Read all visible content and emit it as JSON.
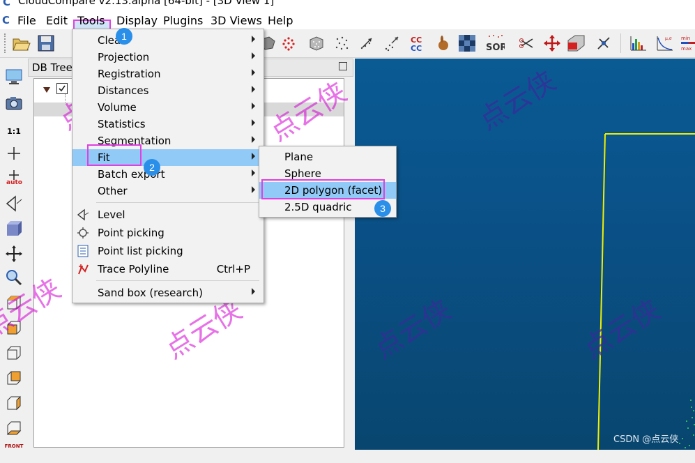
{
  "window": {
    "title": "CloudCompare v2.13.alpha [64-bit] - [3D View 1]"
  },
  "menubar": {
    "items": [
      "File",
      "Edit",
      "Tools",
      "Display",
      "Plugins",
      "3D Views",
      "Help"
    ],
    "active": "Tools"
  },
  "db_tree": {
    "title": "DB Tree"
  },
  "tools_menu": {
    "items": [
      {
        "label": "Clean",
        "has_submenu": true
      },
      {
        "label": "Projection",
        "has_submenu": true
      },
      {
        "label": "Registration",
        "has_submenu": true
      },
      {
        "label": "Distances",
        "has_submenu": true
      },
      {
        "label": "Volume",
        "has_submenu": true
      },
      {
        "label": "Statistics",
        "has_submenu": true
      },
      {
        "label": "Segmentation",
        "has_submenu": true
      },
      {
        "label": "Fit",
        "has_submenu": true,
        "highlighted": true
      },
      {
        "label": "Batch export",
        "has_submenu": true
      },
      {
        "label": "Other",
        "has_submenu": true
      },
      {
        "label": "Level",
        "icon": "level-icon"
      },
      {
        "label": "Point picking",
        "icon": "point-picking-icon"
      },
      {
        "label": "Point list picking",
        "icon": "point-list-icon"
      },
      {
        "label": "Trace Polyline",
        "icon": "trace-polyline-icon",
        "shortcut": "Ctrl+P"
      },
      {
        "label": "Sand box (research)",
        "has_submenu": true
      }
    ]
  },
  "fit_submenu": {
    "items": [
      {
        "label": "Plane"
      },
      {
        "label": "Sphere"
      },
      {
        "label": "2D polygon (facet)",
        "highlighted": true
      },
      {
        "label": "2.5D quadric"
      }
    ]
  },
  "callouts": [
    "1",
    "2",
    "3"
  ],
  "watermark_text": "点云侠",
  "left_toolbar": {
    "scale_label": "1:1",
    "auto_label": "auto",
    "front_label": "FRONT"
  },
  "toolbar_labels": {
    "sor": "SOR",
    "cc": "CC"
  },
  "credit": "CSDN @点云侠",
  "colors": {
    "highlight": "#91c9f7",
    "annotation": "#e040e0",
    "callout": "#2a8fe8",
    "viewport": "#0a5086",
    "polyline": "#f0f000"
  }
}
